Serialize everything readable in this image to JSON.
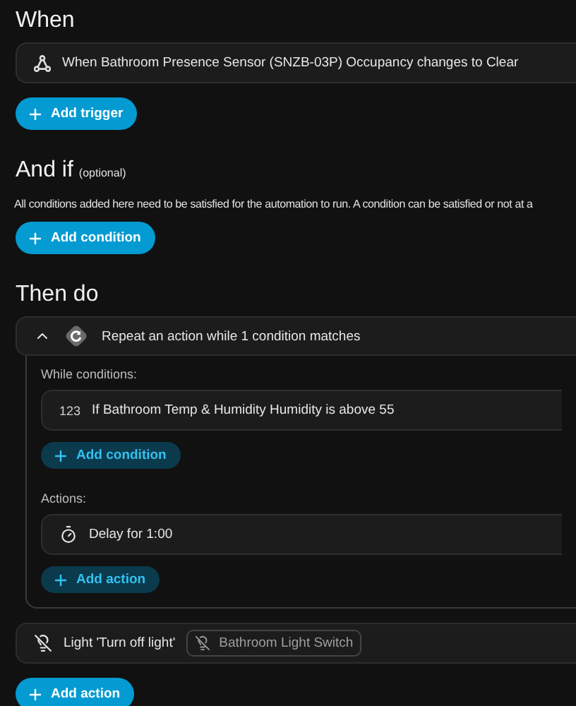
{
  "when": {
    "title": "When",
    "items": [
      {
        "kind": "trigger",
        "text": "When Bathroom Presence Sensor (SNZB-03P) Occupancy changes to Clear"
      }
    ],
    "button": "Add trigger"
  },
  "and_if": {
    "title": "And if",
    "note": "(optional)",
    "description": "All conditions added here need to be satisfied for the automation to run. A condition can be satisfied or not at a",
    "button": "Add condition"
  },
  "then_do": {
    "title": "Then do",
    "actions": [
      {
        "kind": "repeat",
        "text": "Repeat an action while 1 condition matches",
        "expanded": true,
        "while_label": "While conditions:",
        "conditions": [
          {
            "kind": "numeric",
            "icon_text": "123",
            "text": "If Bathroom Temp & Humidity Humidity is above 55"
          }
        ],
        "condition_button": "Add condition",
        "actions_label": "Actions:",
        "actions": [
          {
            "kind": "delay",
            "text": "Delay for 1:00"
          }
        ],
        "action_button": "Add action"
      },
      {
        "kind": "light",
        "text": "Light 'Turn off light'",
        "target": "Bathroom Light Switch"
      }
    ],
    "button": "Add action"
  }
}
